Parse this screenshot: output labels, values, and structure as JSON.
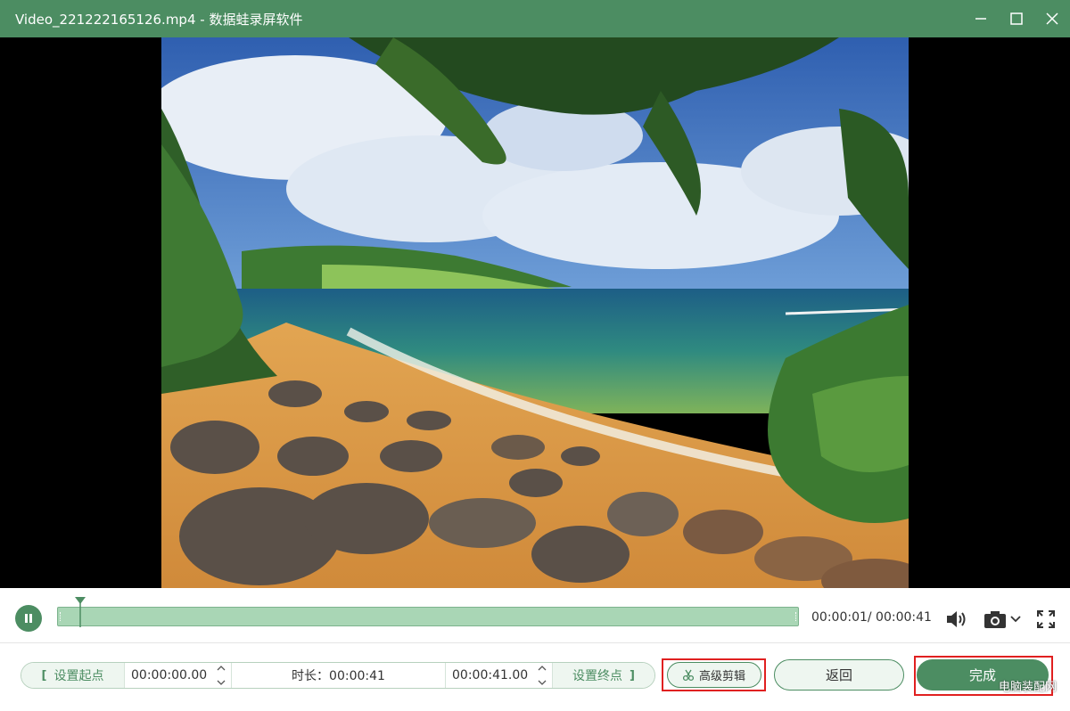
{
  "window": {
    "title": "Video_221222165126.mp4  -  数据蛙录屏软件",
    "controls": [
      "minimize-icon",
      "maximize-icon",
      "close-icon"
    ]
  },
  "player": {
    "state": "playing",
    "current_time": "00:00:01",
    "total_time": "00:00:41",
    "time_display": "00:00:01/ 00:00:41",
    "progress_fraction": 0.024
  },
  "edit": {
    "set_start_label": "设置起点",
    "start_value": "00:00:00.00",
    "duration_label": "时长：00:00:41",
    "end_value": "00:00:41.00",
    "set_end_label": "设置终点",
    "start_bracket": "[",
    "end_bracket": "]"
  },
  "buttons": {
    "advanced_edit": "高级剪辑",
    "back": "返回",
    "done": "完成"
  },
  "watermark": "电脑装配网",
  "colors": {
    "accent": "#4c8d62",
    "timeline": "#a9d6b5",
    "highlight": "#e02020"
  }
}
